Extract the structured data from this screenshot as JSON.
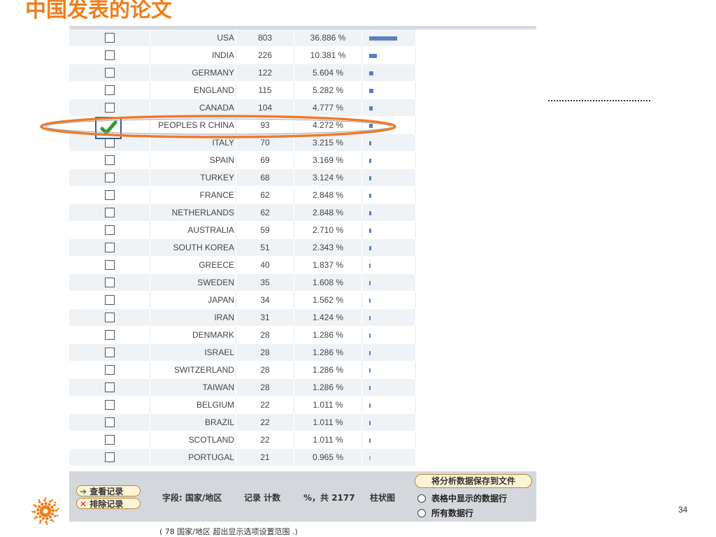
{
  "title": "中国发表的论文",
  "rows": [
    {
      "country": "USA",
      "count": "803",
      "percent": "36.886 %",
      "share": 36.886
    },
    {
      "country": "INDIA",
      "count": "226",
      "percent": "10.381 %",
      "share": 10.381
    },
    {
      "country": "GERMANY",
      "count": "122",
      "percent": "5.604 %",
      "share": 5.604
    },
    {
      "country": "ENGLAND",
      "count": "115",
      "percent": "5.282 %",
      "share": 5.282
    },
    {
      "country": "CANADA",
      "count": "104",
      "percent": "4.777 %",
      "share": 4.777
    },
    {
      "country": "PEOPLES R CHINA",
      "count": "93",
      "percent": "4.272 %",
      "share": 4.272,
      "checked": true
    },
    {
      "country": "ITALY",
      "count": "70",
      "percent": "3.215 %",
      "share": 3.215
    },
    {
      "country": "SPAIN",
      "count": "69",
      "percent": "3.169 %",
      "share": 3.169
    },
    {
      "country": "TURKEY",
      "count": "68",
      "percent": "3.124 %",
      "share": 3.124
    },
    {
      "country": "FRANCE",
      "count": "62",
      "percent": "2.848 %",
      "share": 2.848
    },
    {
      "country": "NETHERLANDS",
      "count": "62",
      "percent": "2.848 %",
      "share": 2.848
    },
    {
      "country": "AUSTRALIA",
      "count": "59",
      "percent": "2.710 %",
      "share": 2.71
    },
    {
      "country": "SOUTH KOREA",
      "count": "51",
      "percent": "2.343 %",
      "share": 2.343
    },
    {
      "country": "GREECE",
      "count": "40",
      "percent": "1.837 %",
      "share": 1.837
    },
    {
      "country": "SWEDEN",
      "count": "35",
      "percent": "1.608 %",
      "share": 1.608
    },
    {
      "country": "JAPAN",
      "count": "34",
      "percent": "1.562 %",
      "share": 1.562
    },
    {
      "country": "IRAN",
      "count": "31",
      "percent": "1.424 %",
      "share": 1.424
    },
    {
      "country": "DENMARK",
      "count": "28",
      "percent": "1.286 %",
      "share": 1.286
    },
    {
      "country": "ISRAEL",
      "count": "28",
      "percent": "1.286 %",
      "share": 1.286
    },
    {
      "country": "SWITZERLAND",
      "count": "28",
      "percent": "1.286 %",
      "share": 1.286
    },
    {
      "country": "TAIWAN",
      "count": "28",
      "percent": "1.286 %",
      "share": 1.286
    },
    {
      "country": "BELGIUM",
      "count": "22",
      "percent": "1.011 %",
      "share": 1.011
    },
    {
      "country": "BRAZIL",
      "count": "22",
      "percent": "1.011 %",
      "share": 1.011
    },
    {
      "country": "SCOTLAND",
      "count": "22",
      "percent": "1.011 %",
      "share": 1.011
    },
    {
      "country": "PORTUGAL",
      "count": "21",
      "percent": "0.965 %",
      "share": 0.965
    }
  ],
  "footer": {
    "view_records_label": "查看记录",
    "exclude_records_label": "排除记录",
    "field_label": "字段: 国家/地区",
    "count_header": "记录 计数",
    "percent_header": "%，共 2177",
    "bar_header": "柱状图",
    "save_button_label": "将分析数据保存到文件",
    "radio_displayed_label": "表格中显示的数据行",
    "radio_all_label": "所有数据行"
  },
  "note": "( 78 国家/地区  超出显示选项设置范围 .)",
  "dots_text": "............................",
  "page_number": "34",
  "colors": {
    "accent": "#f07d1a",
    "bar": "#5b7ec4",
    "checkmark": "#2e9b2e",
    "footer_bg": "#d4d7db"
  }
}
